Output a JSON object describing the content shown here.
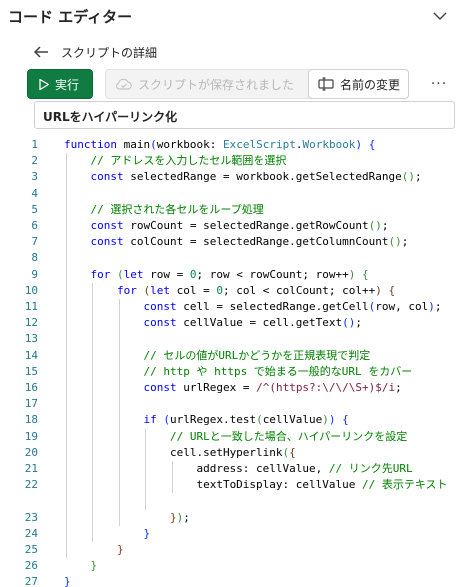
{
  "header": {
    "title": "コード エディター",
    "collapse_icon": "chevron-down-icon"
  },
  "subheader": {
    "back_icon": "arrow-left-icon",
    "label": "スクリプトの詳細"
  },
  "toolbar": {
    "run_label": "実行",
    "saved_label": "スクリプトが保存されました",
    "rename_label": "名前の変更",
    "more_label": "···"
  },
  "script_name": "URLをハイパーリンク化",
  "colors": {
    "accent": "#107c41",
    "keyword": "#0000ff",
    "comment": "#008000",
    "type": "#267f99",
    "number": "#098658",
    "regex": "#811f3f",
    "line_number": "#237893"
  },
  "code_lines": [
    {
      "n": "1",
      "tokens": [
        {
          "c": "kw",
          "t": "function"
        },
        {
          "c": "",
          "t": " main"
        },
        {
          "c": "br1",
          "t": "("
        },
        {
          "c": "",
          "t": "workbook: "
        },
        {
          "c": "ty",
          "t": "ExcelScript"
        },
        {
          "c": "",
          "t": "."
        },
        {
          "c": "ty",
          "t": "Workbook"
        },
        {
          "c": "br1",
          "t": ")"
        },
        {
          "c": "",
          "t": " "
        },
        {
          "c": "br1",
          "t": "{"
        }
      ]
    },
    {
      "n": "2",
      "tokens": [
        {
          "c": "cm",
          "t": "    // アドレスを入力したセル範囲を選択"
        }
      ]
    },
    {
      "n": "3",
      "tokens": [
        {
          "c": "kw",
          "t": "    const"
        },
        {
          "c": "",
          "t": " selectedRange = workbook.getSelectedRange"
        },
        {
          "c": "br2",
          "t": "()"
        },
        {
          "c": "",
          "t": ";"
        }
      ]
    },
    {
      "n": "4",
      "tokens": []
    },
    {
      "n": "5",
      "tokens": [
        {
          "c": "cm",
          "t": "    // 選択された各セルをループ処理"
        }
      ]
    },
    {
      "n": "6",
      "tokens": [
        {
          "c": "kw",
          "t": "    const"
        },
        {
          "c": "",
          "t": " rowCount = selectedRange.getRowCount"
        },
        {
          "c": "br2",
          "t": "()"
        },
        {
          "c": "",
          "t": ";"
        }
      ]
    },
    {
      "n": "7",
      "tokens": [
        {
          "c": "kw",
          "t": "    const"
        },
        {
          "c": "",
          "t": " colCount = selectedRange.getColumnCount"
        },
        {
          "c": "br2",
          "t": "()"
        },
        {
          "c": "",
          "t": ";"
        }
      ]
    },
    {
      "n": "8",
      "tokens": []
    },
    {
      "n": "9",
      "tokens": [
        {
          "c": "kw",
          "t": "    for"
        },
        {
          "c": "",
          "t": " "
        },
        {
          "c": "br2",
          "t": "("
        },
        {
          "c": "kw",
          "t": "let"
        },
        {
          "c": "",
          "t": " row = "
        },
        {
          "c": "num",
          "t": "0"
        },
        {
          "c": "",
          "t": "; row < rowCount; row++"
        },
        {
          "c": "br2",
          "t": ")"
        },
        {
          "c": "",
          "t": " "
        },
        {
          "c": "br2",
          "t": "{"
        }
      ]
    },
    {
      "n": "10",
      "tokens": [
        {
          "c": "kw",
          "t": "        for"
        },
        {
          "c": "",
          "t": " "
        },
        {
          "c": "br3",
          "t": "("
        },
        {
          "c": "kw",
          "t": "let"
        },
        {
          "c": "",
          "t": " col = "
        },
        {
          "c": "num",
          "t": "0"
        },
        {
          "c": "",
          "t": "; col < colCount; col++"
        },
        {
          "c": "br3",
          "t": ")"
        },
        {
          "c": "",
          "t": " "
        },
        {
          "c": "br3",
          "t": "{"
        }
      ]
    },
    {
      "n": "11",
      "tokens": [
        {
          "c": "kw",
          "t": "            const"
        },
        {
          "c": "",
          "t": " cell = selectedRange.getCell"
        },
        {
          "c": "br1",
          "t": "("
        },
        {
          "c": "",
          "t": "row, col"
        },
        {
          "c": "br1",
          "t": ")"
        },
        {
          "c": "",
          "t": ";"
        }
      ]
    },
    {
      "n": "12",
      "tokens": [
        {
          "c": "kw",
          "t": "            const"
        },
        {
          "c": "",
          "t": " cellValue = cell.getText"
        },
        {
          "c": "br1",
          "t": "()"
        },
        {
          "c": "",
          "t": ";"
        }
      ]
    },
    {
      "n": "13",
      "tokens": []
    },
    {
      "n": "14",
      "tokens": [
        {
          "c": "cm",
          "t": "            // セルの値がURLかどうかを正規表現で判定"
        }
      ]
    },
    {
      "n": "15",
      "tokens": [
        {
          "c": "cm",
          "t": "            // http や https で始まる一般的なURL をカバー"
        }
      ]
    },
    {
      "n": "16",
      "tokens": [
        {
          "c": "kw",
          "t": "            const"
        },
        {
          "c": "",
          "t": " urlRegex = "
        },
        {
          "c": "rx",
          "t": "/^(https?:\\/\\/\\S+)$/i"
        },
        {
          "c": "",
          "t": ";"
        }
      ]
    },
    {
      "n": "17",
      "tokens": []
    },
    {
      "n": "18",
      "tokens": [
        {
          "c": "kw",
          "t": "            if"
        },
        {
          "c": "",
          "t": " "
        },
        {
          "c": "br1",
          "t": "("
        },
        {
          "c": "",
          "t": "urlRegex.test"
        },
        {
          "c": "br2",
          "t": "("
        },
        {
          "c": "",
          "t": "cellValue"
        },
        {
          "c": "br2",
          "t": ")"
        },
        {
          "c": "br1",
          "t": ")"
        },
        {
          "c": "",
          "t": " "
        },
        {
          "c": "br1",
          "t": "{"
        }
      ]
    },
    {
      "n": "19",
      "tokens": [
        {
          "c": "cm",
          "t": "                // URLと一致した場合、ハイパーリンクを設定"
        }
      ]
    },
    {
      "n": "20",
      "tokens": [
        {
          "c": "",
          "t": "                cell.setHyperlink"
        },
        {
          "c": "br2",
          "t": "("
        },
        {
          "c": "br3",
          "t": "{"
        }
      ]
    },
    {
      "n": "21",
      "tokens": [
        {
          "c": "",
          "t": "                    address: cellValue, "
        },
        {
          "c": "cm",
          "t": "// リンク先URL"
        }
      ]
    },
    {
      "n": "22",
      "tokens": [
        {
          "c": "",
          "t": "                    textToDisplay: cellValue "
        },
        {
          "c": "cm",
          "t": "// 表示テキスト"
        }
      ]
    },
    {
      "n": "",
      "tokens": []
    },
    {
      "n": "23",
      "tokens": [
        {
          "c": "",
          "t": "                "
        },
        {
          "c": "br3",
          "t": "}"
        },
        {
          "c": "br2",
          "t": ")"
        },
        {
          "c": "",
          "t": ";"
        }
      ]
    },
    {
      "n": "24",
      "tokens": [
        {
          "c": "",
          "t": "            "
        },
        {
          "c": "br1",
          "t": "}"
        }
      ]
    },
    {
      "n": "25",
      "tokens": [
        {
          "c": "",
          "t": "        "
        },
        {
          "c": "br3",
          "t": "}"
        }
      ]
    },
    {
      "n": "26",
      "tokens": [
        {
          "c": "",
          "t": "    "
        },
        {
          "c": "br2",
          "t": "}"
        }
      ]
    },
    {
      "n": "27",
      "tokens": [
        {
          "c": "br1",
          "t": "}"
        }
      ]
    }
  ]
}
